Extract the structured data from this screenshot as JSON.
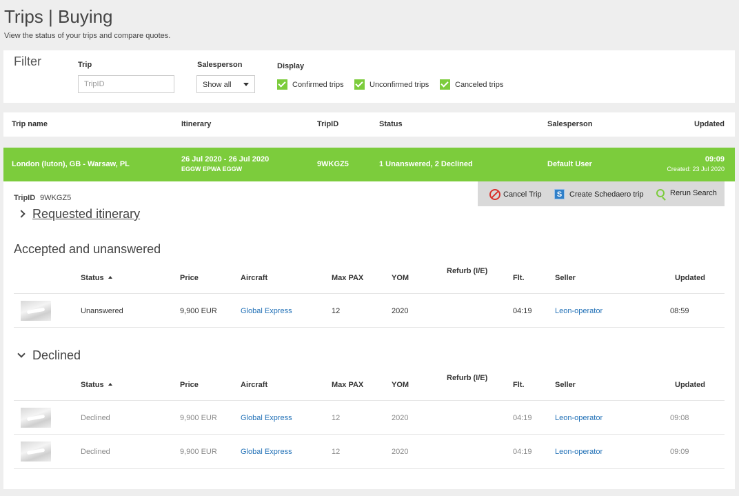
{
  "page": {
    "title": "Trips | Buying",
    "subtitle": "View the status of your trips and compare quotes."
  },
  "filter": {
    "title": "Filter",
    "trip_label": "Trip",
    "trip_placeholder": "TripID",
    "salesperson_label": "Salesperson",
    "salesperson_value": "Show all",
    "display_label": "Display",
    "checkboxes": [
      "Confirmed trips",
      "Unconfirmed trips",
      "Canceled trips"
    ]
  },
  "trips_table": {
    "headers": [
      "Trip name",
      "Itinerary",
      "TripID",
      "Status",
      "Salesperson",
      "Updated"
    ]
  },
  "trip": {
    "name": "London (luton), GB - Warsaw, PL",
    "dates": "26 Jul 2020 - 26 Jul 2020",
    "route": "EGGW EPWA EGGW",
    "trip_id": "9WKGZ5",
    "status": "1 Unanswered, 2 Declined",
    "salesperson": "Default User",
    "updated_time": "09:09",
    "created": "Created: 23 Jul 2020"
  },
  "detail": {
    "tripid_label": "TripID",
    "tripid_value": "9WKGZ5",
    "actions": {
      "cancel": "Cancel Trip",
      "schedaero": "Create Schedaero trip",
      "rerun": "Rerun Search"
    },
    "requested_itinerary": "Requested itinerary",
    "accepted_title": "Accepted and unanswered",
    "declined_title": "Declined"
  },
  "quote_headers": {
    "status": "Status",
    "price": "Price",
    "aircraft": "Aircraft",
    "max_pax": "Max PAX",
    "yom": "YOM",
    "refurb": "Refurb (I/E)",
    "flt": "Flt.",
    "seller": "Seller",
    "updated": "Updated"
  },
  "accepted_quotes": [
    {
      "status": "Unanswered",
      "price": "9,900 EUR",
      "aircraft": "Global Express",
      "max_pax": "12",
      "yom": "2020",
      "refurb": "",
      "flt": "04:19",
      "seller": "Leon-operator",
      "updated": "08:59"
    }
  ],
  "declined_quotes": [
    {
      "status": "Declined",
      "price": "9,900 EUR",
      "aircraft": "Global Express",
      "max_pax": "12",
      "yom": "2020",
      "refurb": "",
      "flt": "04:19",
      "seller": "Leon-operator",
      "updated": "09:08"
    },
    {
      "status": "Declined",
      "price": "9,900 EUR",
      "aircraft": "Global Express",
      "max_pax": "12",
      "yom": "2020",
      "refurb": "",
      "flt": "04:19",
      "seller": "Leon-operator",
      "updated": "09:09"
    }
  ],
  "colors": {
    "accent_green": "#7ccc3c",
    "link_blue": "#1f6fb6",
    "cancel_red": "#d9302c"
  }
}
